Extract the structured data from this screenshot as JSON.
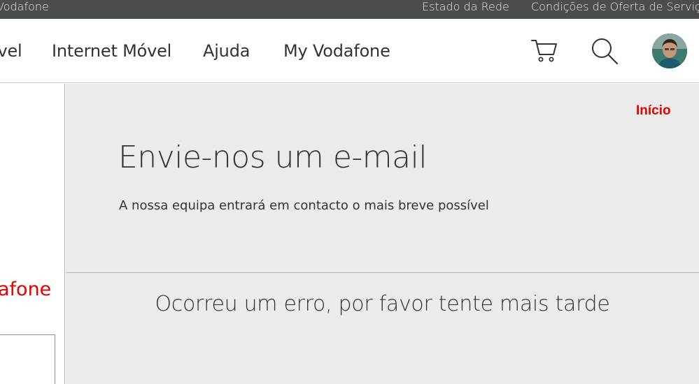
{
  "topbar": {
    "brand_partial": "Vodafone",
    "network_status": "Estado da Rede",
    "offer_terms": "Condições de Oferta de Serviços"
  },
  "nav": {
    "partial_item": "óvel",
    "items": [
      {
        "label": "Internet Móvel"
      },
      {
        "label": "Ajuda"
      },
      {
        "label": "My Vodafone"
      }
    ],
    "icons": {
      "cart": "cart-icon",
      "search": "search-icon",
      "avatar": "avatar"
    }
  },
  "left": {
    "brand_partial": "afone"
  },
  "main": {
    "home_link": "Início",
    "title": "Envie-nos um e-mail",
    "subtitle": "A nossa equipa entrará em contacto o mais breve possível",
    "error": "Ocorreu um erro, por favor tente mais tarde"
  },
  "colors": {
    "brand_red": "#e60000",
    "topbar_bg": "#4a4d4e",
    "panel_bg": "#ebebeb",
    "text": "#333333"
  }
}
